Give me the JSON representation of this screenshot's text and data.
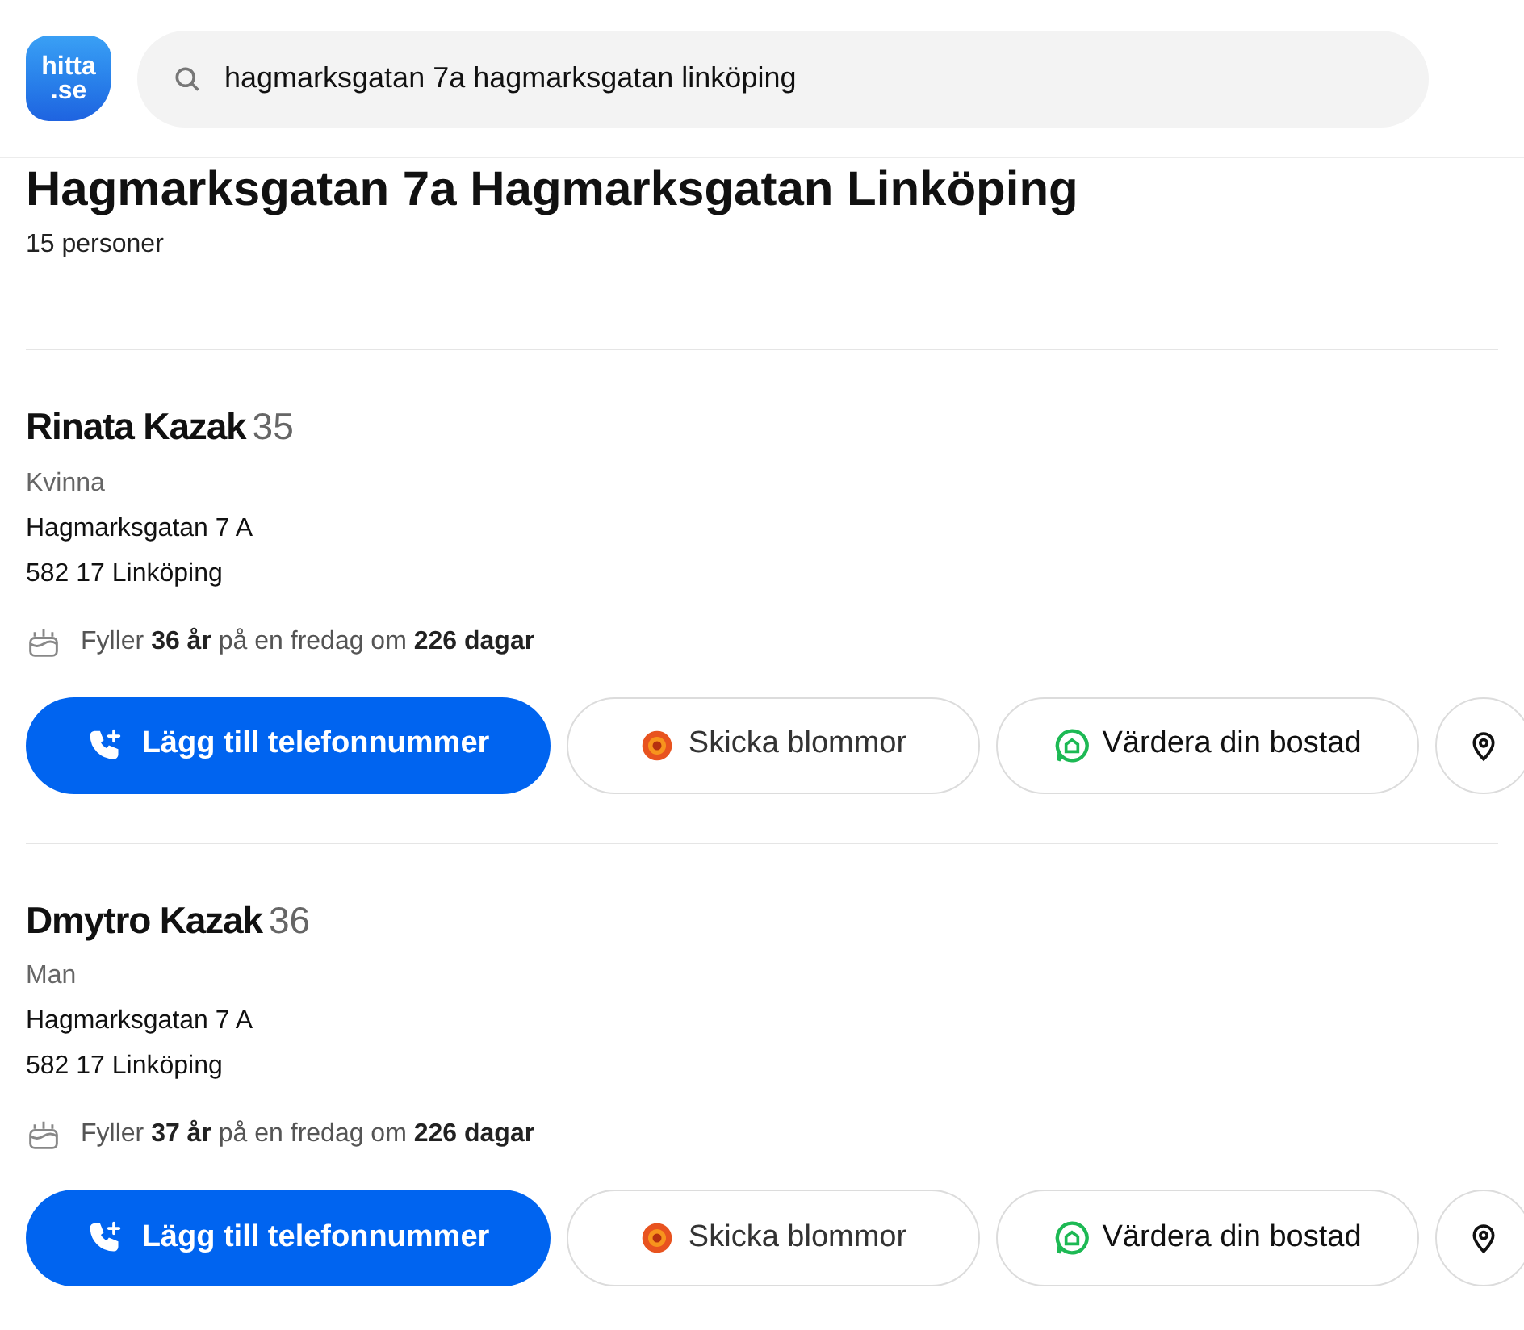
{
  "header": {
    "logo_top": "hitta",
    "logo_bottom": ".se",
    "search": {
      "value": "hagmarksgatan 7a hagmarksgatan linköping"
    }
  },
  "heading": "Hagmarksgatan 7a Hagmarksgatan Linköping",
  "count": "15 personer",
  "persons": [
    {
      "name": "Rinata Kazak",
      "age": "35",
      "gender": "Kvinna",
      "street": "Hagmarksgatan 7 A",
      "city": "582 17 Linköping",
      "birthday": "Fyller **36 år** på en fredag om **226 dagar**",
      "actions": [
        {
          "kind": "phone",
          "label": "Lägg till telefonnummer"
        },
        {
          "kind": "flowers",
          "label": "Skicka blommor"
        },
        {
          "kind": "valuation",
          "label": "Värdera din bostad"
        },
        {
          "kind": "map"
        }
      ]
    },
    {
      "name": "Dmytro Kazak",
      "age": "36",
      "gender": "Man",
      "street": "Hagmarksgatan 7 A",
      "city": "582 17 Linköping",
      "birthday": "Fyller **37 år** på en fredag om **226 dagar**",
      "actions": [
        {
          "kind": "phone",
          "label": "Lägg till telefonnummer"
        },
        {
          "kind": "flowers",
          "label": "Skicka blommor"
        },
        {
          "kind": "valuation",
          "label": "Värdera din bostad"
        },
        {
          "kind": "map"
        }
      ]
    }
  ]
}
